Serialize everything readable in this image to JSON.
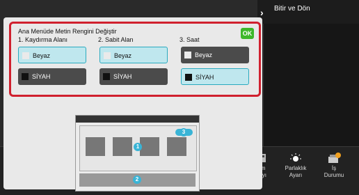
{
  "header": {
    "finish_label": "Bitir ve Dön"
  },
  "dialog": {
    "title": "Ana Menüde Metin Rengini Değiştir",
    "ok_label": "OK",
    "columns": [
      {
        "label": "1. Kaydırma Alanı",
        "white": "Beyaz",
        "black": "SİYAH",
        "selected": "white"
      },
      {
        "label": "2. Sabit Alan",
        "white": "Beyaz",
        "black": "SİYAH",
        "selected": "white"
      },
      {
        "label": "3. Saat",
        "white": "Beyaz",
        "black": "SİYAH",
        "selected": "black"
      }
    ]
  },
  "preview": {
    "badge1": "1",
    "badge2": "2",
    "badge3": "3"
  },
  "bottombar": {
    "item1": [
      "lam",
      "Sayı"
    ],
    "item2": [
      "Parlaklık",
      "Ayarı"
    ],
    "item3": [
      "İş",
      "Durumu"
    ]
  },
  "colors": {
    "highlight": "#d0202e",
    "ok": "#3db82a",
    "selected": "#bfe7ee",
    "badge": "#39b4d6"
  }
}
